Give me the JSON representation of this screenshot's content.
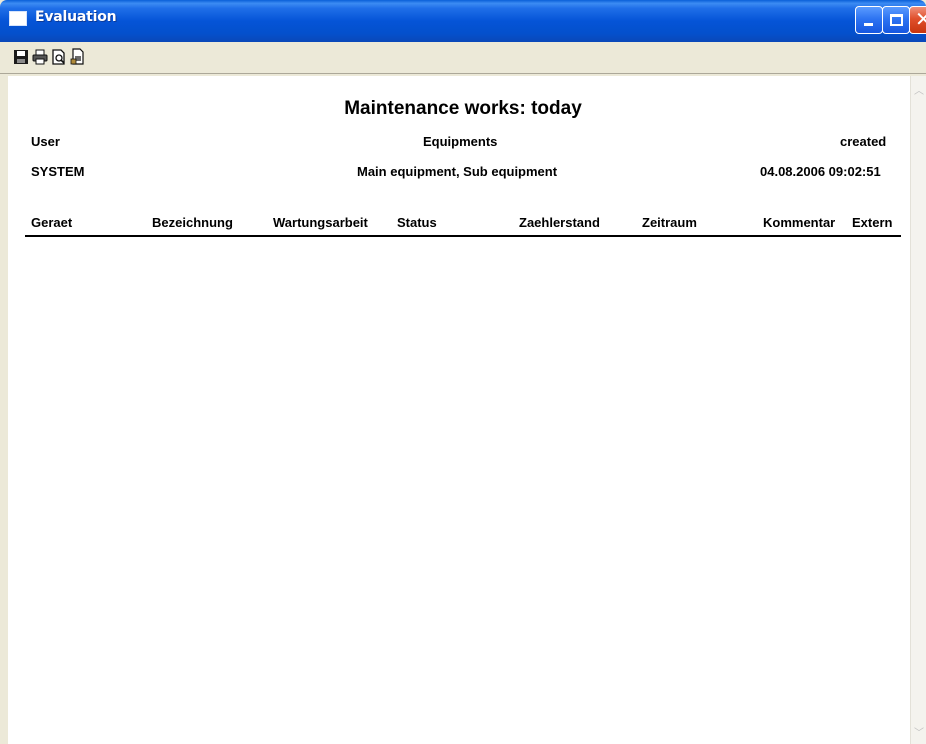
{
  "window": {
    "title": "Evaluation"
  },
  "toolbar": {
    "icons": [
      "save-icon",
      "print-icon",
      "print-preview-icon",
      "export-icon"
    ]
  },
  "report": {
    "title": "Maintenance works: today",
    "labels": {
      "user": "User",
      "equipments": "Equipments",
      "created": "created"
    },
    "values": {
      "user": "SYSTEM",
      "equipments": "Main equipment, Sub equipment",
      "created": "04.08.2006 09:02:51"
    },
    "columns": [
      "Geraet",
      "Bezeichnung",
      "Wartungsarbeit",
      "Status",
      "Zaehlerstand",
      "Zeitraum",
      "Kommentar",
      "Extern"
    ]
  },
  "colors": {
    "titlebar": "#0554d7",
    "chrome": "#ece9d8",
    "close": "#e0502c"
  }
}
